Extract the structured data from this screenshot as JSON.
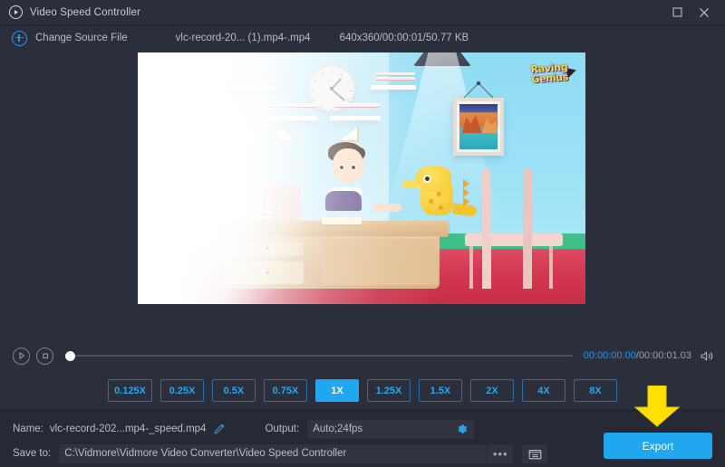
{
  "window": {
    "title": "Video Speed Controller",
    "logo_icon": "circle-play-icon",
    "maximize_icon": "maximize-icon",
    "close_icon": "close-icon"
  },
  "source_bar": {
    "add_icon": "plus-circle-icon",
    "change_source_label": "Change Source File",
    "file_name": "vlc-record-20... (1).mp4-.mp4",
    "file_meta": "640x360/00:00:01/50.77 KB"
  },
  "preview": {
    "watermark_line1": "Raving",
    "watermark_line2": "Genius",
    "scene_description": "Cartoon boy studying at a desk with a yellow dinosaur"
  },
  "player": {
    "play_icon": "play-icon",
    "stop_icon": "stop-icon",
    "progress_percent": 0,
    "current_time": "00:00:00.00",
    "total_time": "/00:00:01.03",
    "volume_icon": "volume-icon"
  },
  "speeds": {
    "options": [
      {
        "label": "0.125X",
        "active": false
      },
      {
        "label": "0.25X",
        "active": false
      },
      {
        "label": "0.5X",
        "active": false
      },
      {
        "label": "0.75X",
        "active": false
      },
      {
        "label": "1X",
        "active": true
      },
      {
        "label": "1.25X",
        "active": false
      },
      {
        "label": "1.5X",
        "active": false
      },
      {
        "label": "2X",
        "active": false
      },
      {
        "label": "4X",
        "active": false
      },
      {
        "label": "8X",
        "active": false
      }
    ]
  },
  "bottom": {
    "name_label": "Name:",
    "name_value": "vlc-record-202...mp4-_speed.mp4",
    "edit_icon": "pencil-icon",
    "output_label": "Output:",
    "output_value": "Auto;24fps",
    "settings_icon": "gear-icon",
    "saveto_label": "Save to:",
    "saveto_value": "C:\\Vidmore\\Vidmore Video Converter\\Video Speed Controller",
    "browse_label": "•••",
    "open_folder_icon": "folder-icon",
    "export_label": "Export",
    "annotation_icon": "down-arrow-annotation"
  },
  "colors": {
    "accent": "#21a7f0",
    "window_bg": "#2b2f3b",
    "panel_bg": "#272a35",
    "field_bg": "#31343f",
    "text": "#b9bdc8",
    "annotation": "#ffe000"
  }
}
